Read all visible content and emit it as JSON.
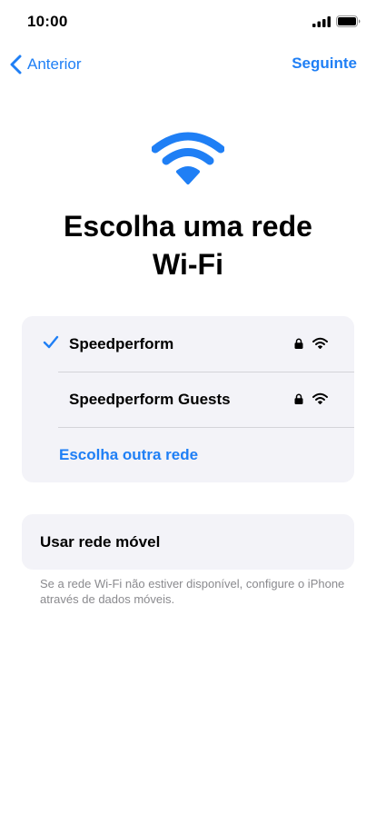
{
  "status_bar": {
    "time": "10:00"
  },
  "nav": {
    "back_label": "Anterior",
    "next_label": "Seguinte"
  },
  "title": "Escolha uma rede\nWi-Fi",
  "networks": [
    {
      "name": "Speedperform",
      "selected": true,
      "secured": true,
      "icon": "wifi-icon"
    },
    {
      "name": "Speedperform Guests",
      "selected": false,
      "secured": true,
      "icon": "wifi-icon"
    }
  ],
  "other_network_label": "Escolha outra rede",
  "cellular": {
    "label": "Usar rede móvel",
    "note": "Se a rede Wi-Fi não estiver disponível, configure o iPhone através de dados móveis."
  },
  "colors": {
    "accent": "#1f7ff5",
    "card_bg": "#f3f3f8",
    "secondary_text": "#8a8a8e"
  }
}
